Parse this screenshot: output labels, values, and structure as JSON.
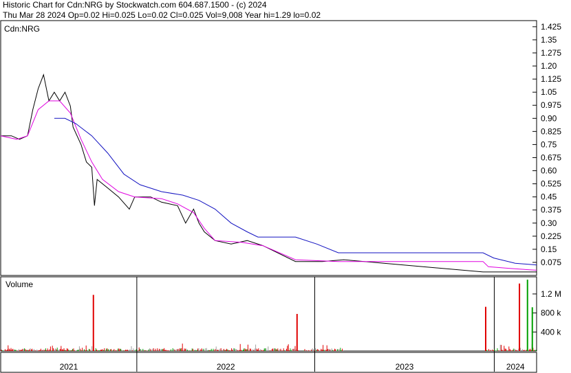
{
  "header": {
    "line1": "Historic Chart for Cdn:NRG by Stockwatch.com 604.687.1500 - (c) 2024",
    "line2": "Thu Mar 28 2024  Op=0.02  Hi=0.025  Lo=0.02  Cl=0.025  Vol=9,008  Year hi=1.29  lo=0.02"
  },
  "chart_data": {
    "type": "line",
    "symbol_label": "Cdn:NRG",
    "volume_label": "Volume",
    "price_ticks": [
      "1.425",
      "1.35",
      "1.275",
      "1.20",
      "1.125",
      "1.05",
      "0.975",
      "0.90",
      "0.825",
      "0.75",
      "0.675",
      "0.60",
      "0.525",
      "0.45",
      "0.375",
      "0.30",
      "0.225",
      "0.15",
      "0.075"
    ],
    "volume_ticks": [
      "1.2 M",
      "800 k",
      "400 k"
    ],
    "year_labels": [
      "2021",
      "2022",
      "2023",
      "2024"
    ],
    "price_range": [
      0,
      1.46
    ],
    "volume_range": [
      0,
      1.56
    ],
    "colors": {
      "price": "#000000",
      "short_ma": "#e000e0",
      "long_ma": "#1010c0",
      "vol_up": "#00a000",
      "vol_down": "#e00000",
      "vol_flat": "#a0a0a0",
      "grid": "#000000"
    },
    "series": [
      {
        "values": [
          [
            0,
            0.8
          ],
          [
            0.02,
            0.8
          ],
          [
            0.035,
            0.78
          ],
          [
            0.05,
            0.8
          ],
          [
            0.06,
            0.95
          ],
          [
            0.07,
            1.07
          ],
          [
            0.08,
            1.15
          ],
          [
            0.09,
            1.0
          ],
          [
            0.1,
            1.05
          ],
          [
            0.11,
            1.0
          ],
          [
            0.12,
            1.05
          ],
          [
            0.13,
            0.97
          ],
          [
            0.135,
            0.85
          ],
          [
            0.15,
            0.75
          ],
          [
            0.16,
            0.65
          ],
          [
            0.17,
            0.62
          ],
          [
            0.175,
            0.4
          ],
          [
            0.18,
            0.55
          ],
          [
            0.2,
            0.5
          ],
          [
            0.22,
            0.45
          ],
          [
            0.24,
            0.38
          ],
          [
            0.25,
            0.45
          ],
          [
            0.28,
            0.45
          ],
          [
            0.3,
            0.42
          ],
          [
            0.33,
            0.4
          ],
          [
            0.345,
            0.3
          ],
          [
            0.36,
            0.38
          ],
          [
            0.37,
            0.3
          ],
          [
            0.38,
            0.25
          ],
          [
            0.4,
            0.2
          ],
          [
            0.43,
            0.18
          ],
          [
            0.46,
            0.2
          ],
          [
            0.49,
            0.17
          ],
          [
            0.55,
            0.08
          ],
          [
            0.6,
            0.08
          ],
          [
            0.64,
            0.09
          ],
          [
            0.9,
            0.02
          ],
          [
            1.0,
            0.02
          ]
        ]
      },
      {
        "values": [
          [
            0,
            0.8
          ],
          [
            0.03,
            0.78
          ],
          [
            0.05,
            0.8
          ],
          [
            0.07,
            0.95
          ],
          [
            0.09,
            1.0
          ],
          [
            0.11,
            1.0
          ],
          [
            0.13,
            0.93
          ],
          [
            0.15,
            0.78
          ],
          [
            0.17,
            0.65
          ],
          [
            0.19,
            0.55
          ],
          [
            0.22,
            0.48
          ],
          [
            0.25,
            0.45
          ],
          [
            0.3,
            0.44
          ],
          [
            0.33,
            0.41
          ],
          [
            0.36,
            0.36
          ],
          [
            0.38,
            0.27
          ],
          [
            0.4,
            0.2
          ],
          [
            0.45,
            0.19
          ],
          [
            0.49,
            0.17
          ],
          [
            0.55,
            0.09
          ],
          [
            0.63,
            0.08
          ],
          [
            0.9,
            0.08
          ],
          [
            0.91,
            0.05
          ],
          [
            0.95,
            0.04
          ],
          [
            1.0,
            0.03
          ]
        ]
      },
      {
        "values": [
          [
            0.1,
            0.9
          ],
          [
            0.12,
            0.9
          ],
          [
            0.14,
            0.87
          ],
          [
            0.17,
            0.8
          ],
          [
            0.2,
            0.7
          ],
          [
            0.23,
            0.58
          ],
          [
            0.26,
            0.52
          ],
          [
            0.3,
            0.48
          ],
          [
            0.34,
            0.46
          ],
          [
            0.37,
            0.43
          ],
          [
            0.4,
            0.38
          ],
          [
            0.43,
            0.3
          ],
          [
            0.46,
            0.25
          ],
          [
            0.48,
            0.22
          ],
          [
            0.55,
            0.22
          ],
          [
            0.59,
            0.18
          ],
          [
            0.63,
            0.13
          ],
          [
            0.9,
            0.13
          ],
          [
            0.92,
            0.1
          ],
          [
            0.96,
            0.07
          ],
          [
            1.0,
            0.06
          ]
        ]
      }
    ]
  }
}
